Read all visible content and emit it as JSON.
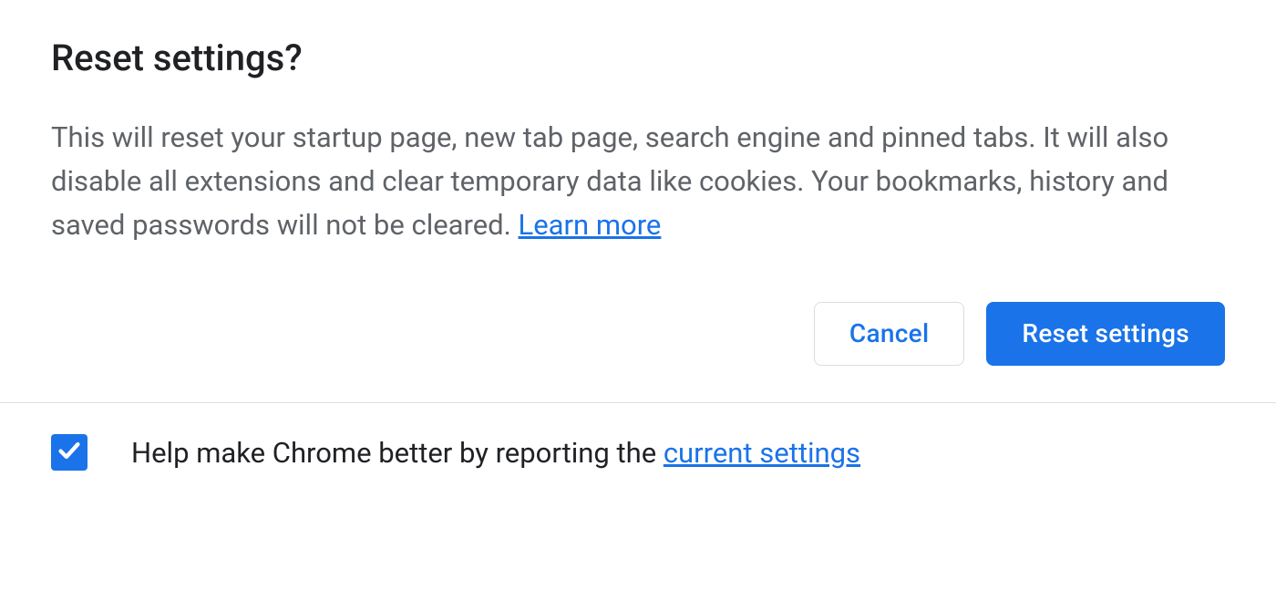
{
  "dialog": {
    "title": "Reset settings?",
    "body": "This will reset your startup page, new tab page, search engine and pinned tabs. It will also disable all extensions and clear temporary data like cookies. Your bookmarks, history and saved passwords will not be cleared. ",
    "learn_more_label": "Learn more",
    "cancel_label": "Cancel",
    "confirm_label": "Reset settings"
  },
  "footer": {
    "checkbox_checked": true,
    "text_prefix": "Help make Chrome better by reporting the ",
    "link_label": "current settings"
  },
  "colors": {
    "primary": "#1a73e8",
    "text_primary": "#202124",
    "text_secondary": "#5f6368",
    "border": "#dadce0"
  }
}
